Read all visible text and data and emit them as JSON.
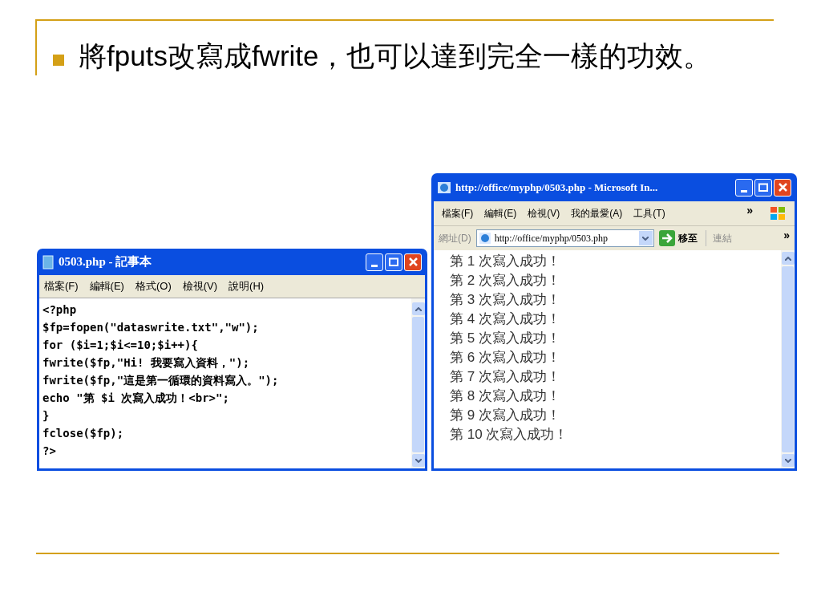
{
  "slide": {
    "bullet_text": "將fputs改寫成fwrite，也可以達到完全一樣的功效。"
  },
  "notepad": {
    "title": "0503.php - 記事本",
    "menu": [
      "檔案(F)",
      "編輯(E)",
      "格式(O)",
      "檢視(V)",
      "說明(H)"
    ],
    "lines": [
      "<?php",
      "$fp=fopen(\"dataswrite.txt\",\"w\");",
      "for ($i=1;$i<=10;$i++){",
      "fwrite($fp,\"Hi! 我要寫入資料，\");",
      "fwrite($fp,\"這是第一循環的資料寫入。\");",
      "echo \"第 $i 次寫入成功！<br>\";",
      "}",
      "fclose($fp);",
      "?>"
    ]
  },
  "browser": {
    "title": "http://office/myphp/0503.php - Microsoft In...",
    "menu": [
      "檔案(F)",
      "編輯(E)",
      "檢視(V)",
      "我的最愛(A)",
      "工具(T)"
    ],
    "menu_more": "»",
    "address_label": "網址(D)",
    "address": "http://office/myphp/0503.php",
    "go_label": "移至",
    "links_label": "連結",
    "links_more": "»",
    "lines": [
      "第 1 次寫入成功！",
      "第 2 次寫入成功！",
      "第 3 次寫入成功！",
      "第 4 次寫入成功！",
      "第 5 次寫入成功！",
      "第 6 次寫入成功！",
      "第 7 次寫入成功！",
      "第 8 次寫入成功！",
      "第 9 次寫入成功！",
      "第 10 次寫入成功！"
    ]
  }
}
